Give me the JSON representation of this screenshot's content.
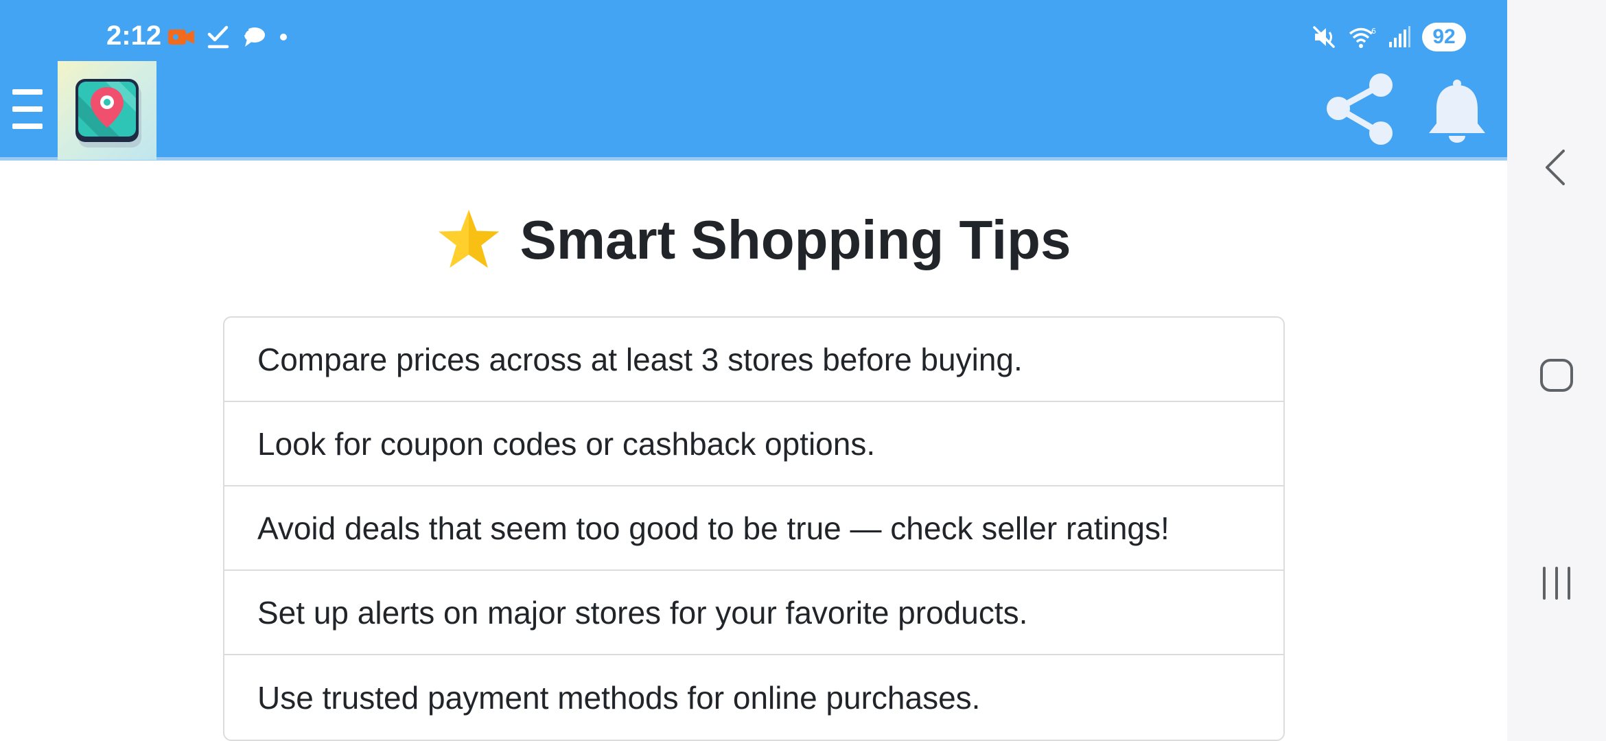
{
  "status_bar": {
    "time": "2:12",
    "battery": "92",
    "left_icons": [
      "video-record-icon",
      "task-check-icon",
      "chat-bubble-icon",
      "dot-icon"
    ],
    "right_icons": [
      "mute-icon",
      "wifi-icon",
      "signal-icon"
    ]
  },
  "app_bar": {
    "icons": [
      "menu-icon",
      "app-logo-map-pin-icon",
      "share-icon",
      "bell-icon"
    ],
    "background_color": "#44a4f4"
  },
  "main": {
    "title_icon": "star-icon",
    "title": "Smart Shopping Tips",
    "tips": [
      "Compare prices across at least 3 stores before buying.",
      "Look for coupon codes or cashback options.",
      "Avoid deals that seem too good to be true — check seller ratings!",
      "Set up alerts on major stores for your favorite products.",
      "Use trusted payment methods for online purchases."
    ]
  },
  "nav_bar": {
    "buttons": [
      "back-icon",
      "home-icon",
      "recents-icon"
    ]
  }
}
